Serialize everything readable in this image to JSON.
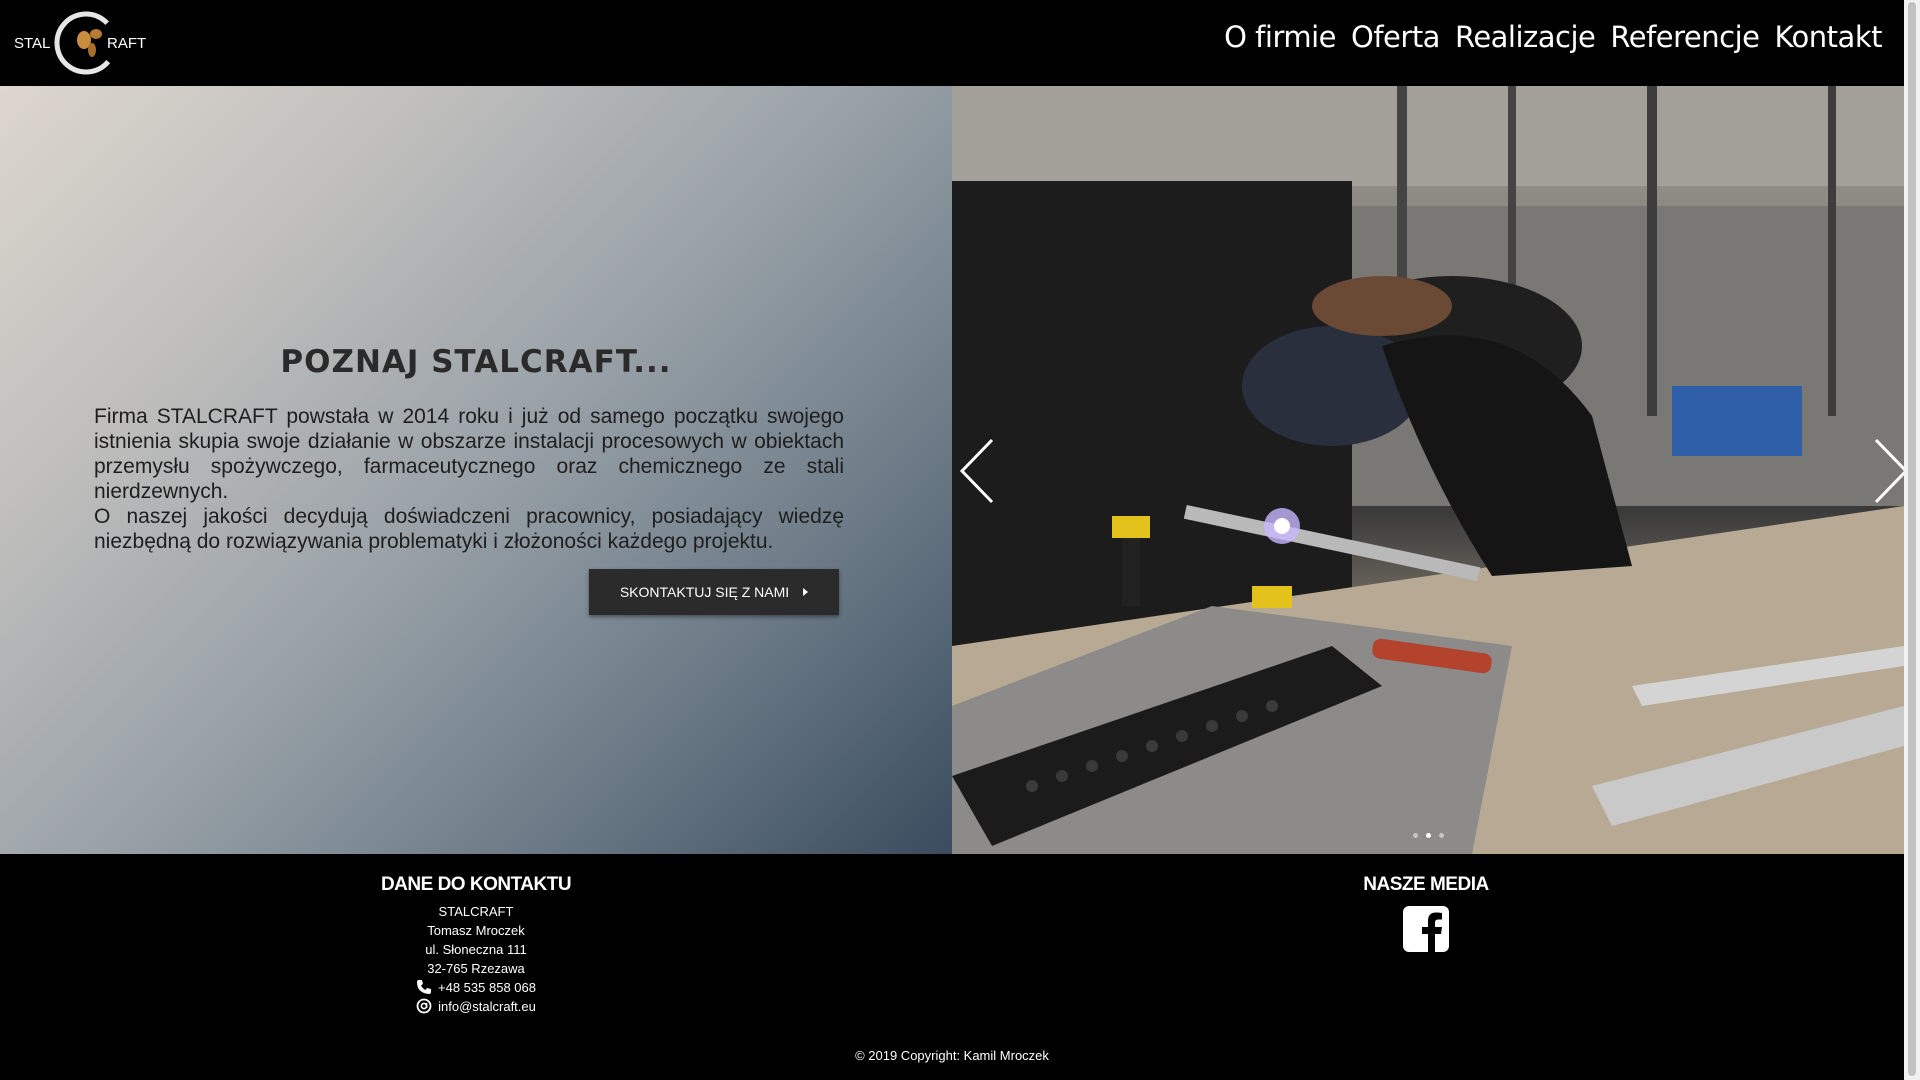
{
  "logo": {
    "text_left": "STAL",
    "text_right": "RAFT",
    "alt": "STALCRAFT"
  },
  "nav": [
    {
      "label": "O firmie"
    },
    {
      "label": "Oferta"
    },
    {
      "label": "Realizacje"
    },
    {
      "label": "Referencje"
    },
    {
      "label": "Kontakt"
    }
  ],
  "hero": {
    "title": "POZNAJ STALCRAFT...",
    "paragraphs": [
      "Firma STALCRAFT powstała w 2014 roku i już od samego początku swojego istnienia skupia swoje działanie w obszarze instalacji procesowych w obiektach przemysłu spożywczego, farmaceutycznego oraz chemicznego ze stali nierdzewnych.",
      "O naszej jakości decydują doświadczeni pracownicy, posiadający wiedzę niezbędną do rozwiązywania problematyki i złożoności każdego projektu."
    ],
    "cta_label": "SKONTAKTUJ SIĘ Z NAMI"
  },
  "carousel": {
    "slide_count": 3,
    "active_slide": 2,
    "prev_icon": "chevron-left-icon",
    "next_icon": "chevron-right-icon"
  },
  "footer": {
    "contact": {
      "heading": "DANE DO KONTAKTU",
      "company": "STALCRAFT",
      "person": "Tomasz Mroczek",
      "street": "ul. Słoneczna 111",
      "city": "32-765 Rzezawa",
      "phone": "+48 535 858 068",
      "email": "info@stalcraft.eu"
    },
    "media": {
      "heading": "NASZE MEDIA",
      "icon": "facebook-icon"
    },
    "copyright": "© 2019 Copyright: Kamil Mroczek"
  }
}
